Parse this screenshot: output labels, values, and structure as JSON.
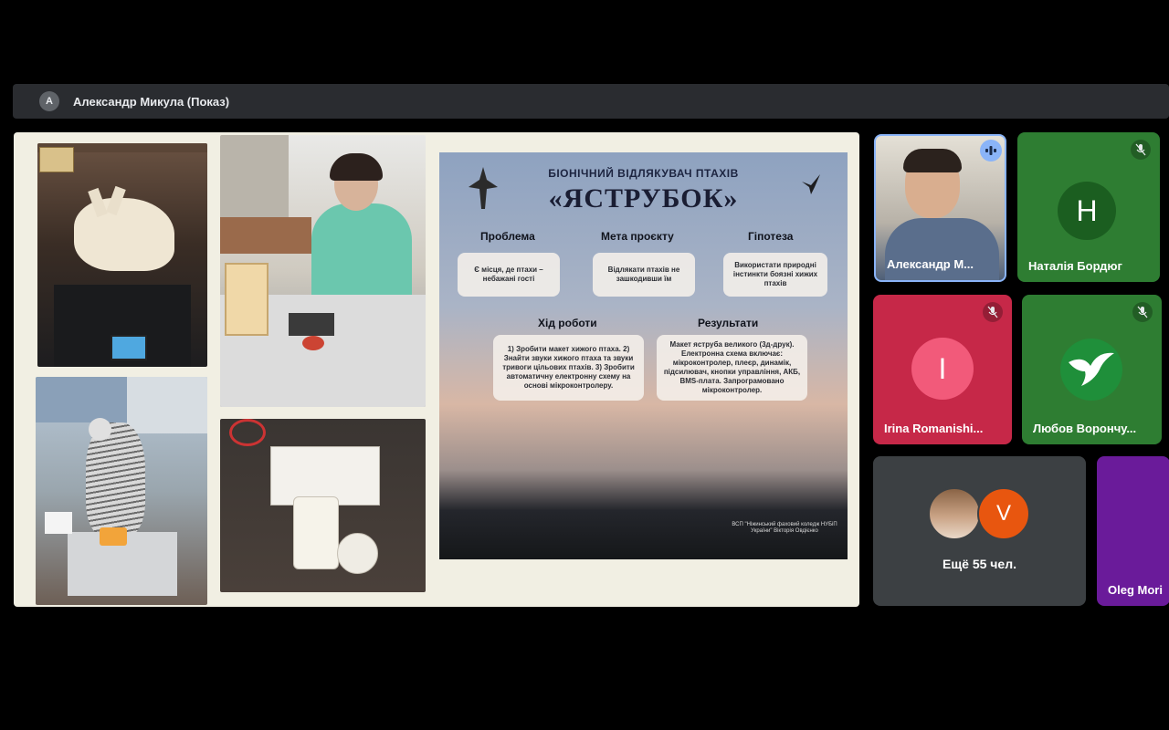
{
  "presenter_banner": {
    "avatar_initial": "A",
    "name": "Александр Микула (Показ)"
  },
  "poster": {
    "title": "БІОНІЧНИЙ ВІДЛЯКУВАЧ ПТАХІВ",
    "name": "«ЯСТРУБОК»",
    "sections": {
      "problem": {
        "heading": "Проблема",
        "text": "Є місця, де птахи – небажані гості"
      },
      "goal": {
        "heading": "Мета проєкту",
        "text": "Відлякати птахів не зашкодивши їм"
      },
      "hypothesis": {
        "heading": "Гіпотеза",
        "text": "Використати природні інстинкти боязні хижих птахів"
      },
      "progress": {
        "heading": "Хід роботи",
        "text": "1) Зробити макет хижого птаха. 2) Знайти звуки хижого птаха та звуки тривоги цільових птахів. 3) Зробити автоматичну електронну схему на основі мікроконтролеру."
      },
      "results": {
        "heading": "Результати",
        "text": "Макет яструба великого (3д-друк). Електронна схема включає: мікроконтролер, плеєр, динамік, підсилювач, кнопки управління, АКБ, BMS-плата. Запрограмовано мікроконтролер."
      }
    },
    "credit": "ВСП \"Ніжинський фаховий коледж НУБіП України\" Вікторія Овдієнко"
  },
  "participants": [
    {
      "name": "Александр М...",
      "type": "video",
      "status": "speaking"
    },
    {
      "name": "Наталія Бордюг",
      "initial": "Н",
      "status": "muted",
      "color": "#2e7d32"
    },
    {
      "name": "Irina Romanishi...",
      "initial": "I",
      "status": "muted",
      "color": "#e53958"
    },
    {
      "name": "Любов Ворончу...",
      "status": "muted",
      "avatar": "bird-logo"
    },
    {
      "more_label": "Ещё 55 чел.",
      "avatar_initial": "V"
    },
    {
      "name": "Oleg Mori"
    }
  ]
}
